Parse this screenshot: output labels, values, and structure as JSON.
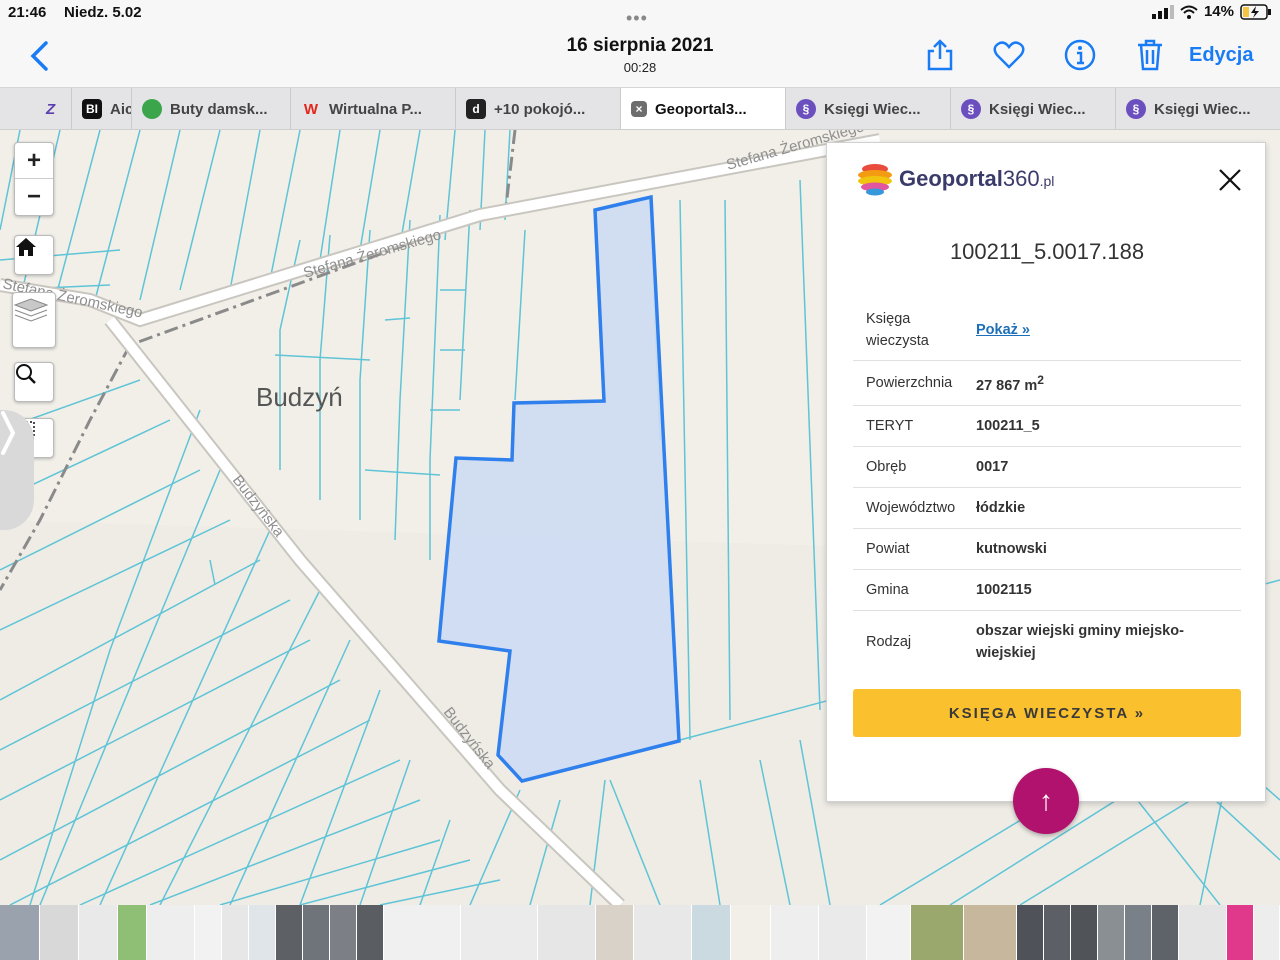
{
  "status": {
    "time": "21:46",
    "date": "Niedz. 5.02",
    "battery": "14%"
  },
  "header": {
    "title": "16 sierpnia 2021",
    "subtitle": "00:28",
    "edit_label": "Edycja"
  },
  "tabs": [
    {
      "label": "Z",
      "fav_color": "#5b3fb0",
      "fav_text": "Z"
    },
    {
      "label": "Aic",
      "fav_color": "#111111",
      "fav_text": "BI"
    },
    {
      "label": "Buty damsk...",
      "fav_color": "#3aa54a",
      "fav_text": ""
    },
    {
      "label": "Wirtualna P...",
      "fav_color": "#e3261c",
      "fav_text": "W"
    },
    {
      "label": "+10 pokojó...",
      "fav_color": "#222222",
      "fav_text": "d"
    },
    {
      "label": "Geoportal3...",
      "fav_color": "#6d6d6d",
      "fav_text": "×"
    },
    {
      "label": "Księgi Wiec...",
      "fav_color": "#6b4fbf",
      "fav_text": "§"
    },
    {
      "label": "Księgi Wiec...",
      "fav_color": "#6b4fbf",
      "fav_text": "§"
    },
    {
      "label": "Księgi Wiec...",
      "fav_color": "#6b4fbf",
      "fav_text": "§"
    }
  ],
  "map": {
    "place_label": "Budzyń",
    "road_labels": [
      "Stefana Żeromskiego",
      "Stefana Żeromskiego",
      "Stefana Żeromskiego",
      "Budzyńska",
      "Budzyńska"
    ],
    "zoom_in": "+",
    "zoom_out": "−"
  },
  "panel": {
    "logo_name": "Geoportal",
    "logo_num": "360",
    "logo_tld": ".pl",
    "parcel_id": "100211_5.0017.188",
    "rows": [
      {
        "key": "Księga wieczysta",
        "value": "Pokaż »"
      },
      {
        "key": "Powierzchnia",
        "value": "27 867 m",
        "sup": "2"
      },
      {
        "key": "TERYT",
        "value": "100211_5"
      },
      {
        "key": "Obręb",
        "value": "0017"
      },
      {
        "key": "Województwo",
        "value": "łódzkie"
      },
      {
        "key": "Powiat",
        "value": "kutnowski"
      },
      {
        "key": "Gmina",
        "value": "1002115"
      },
      {
        "key": "Rodzaj",
        "value": "obszar wiejski gminy miejsko-wiejskiej"
      }
    ],
    "button_label": "KSIĘGA WIECZYSTA »",
    "fab_label": "↑"
  },
  "colors": {
    "accent": "#1a7cf5",
    "parcel_stroke": "#2f80ed",
    "parcel_fill": "#cddcf3",
    "button": "#fbc02d",
    "fab": "#b0126e",
    "cadastral": "#5ec4d6"
  }
}
